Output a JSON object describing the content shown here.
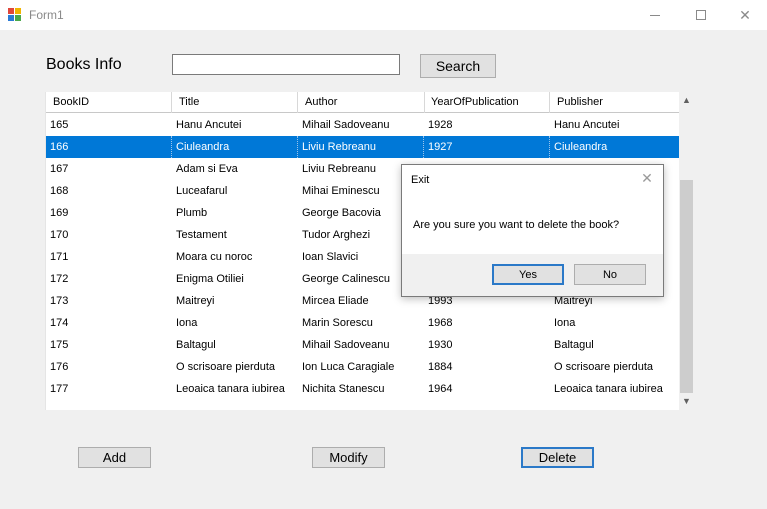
{
  "window": {
    "title": "Form1",
    "minimize_icon": "minimize-icon",
    "maximize_icon": "maximize-icon",
    "close_icon": "close-icon"
  },
  "form": {
    "label": "Books Info",
    "search_value": "",
    "search_label": "Search"
  },
  "grid": {
    "columns": [
      "BookID",
      "Title",
      "Author",
      "YearOfPublication",
      "Publisher"
    ],
    "selected_index": 1,
    "rows": [
      [
        "165",
        "Hanu Ancutei",
        "Mihail Sadoveanu",
        "1928",
        "Hanu Ancutei"
      ],
      [
        "166",
        "Ciuleandra",
        "Liviu Rebreanu",
        "1927",
        "Ciuleandra"
      ],
      [
        "167",
        "Adam si Eva",
        "Liviu Rebreanu",
        "",
        ""
      ],
      [
        "168",
        "Luceafarul",
        "Mihai Eminescu",
        "",
        ""
      ],
      [
        "169",
        "Plumb",
        "George Bacovia",
        "",
        ""
      ],
      [
        "170",
        "Testament",
        "Tudor Arghezi",
        "",
        ""
      ],
      [
        "171",
        "Moara cu noroc",
        "Ioan Slavici",
        "",
        ""
      ],
      [
        "172",
        "Enigma Otiliei",
        "George Calinescu",
        "",
        ""
      ],
      [
        "173",
        "Maitreyi",
        "Mircea Eliade",
        "1993",
        "Maitreyi"
      ],
      [
        "174",
        "Iona",
        "Marin Sorescu",
        "1968",
        "Iona"
      ],
      [
        "175",
        "Baltagul",
        "Mihail Sadoveanu",
        "1930",
        "Baltagul"
      ],
      [
        "176",
        "O scrisoare pierduta",
        "Ion Luca Caragiale",
        "1884",
        "O scrisoare pierduta"
      ],
      [
        "177",
        "Leoaica tanara iubirea",
        "Nichita Stanescu",
        "1964",
        "Leoaica tanara iubirea"
      ]
    ]
  },
  "buttons": {
    "add": "Add",
    "modify": "Modify",
    "delete": "Delete"
  },
  "dialog": {
    "title": "Exit",
    "message": "Are you sure you want to delete the book?",
    "yes": "Yes",
    "no": "No"
  },
  "colors": {
    "selection": "#0078d7",
    "focus_border": "#2b79c8"
  }
}
